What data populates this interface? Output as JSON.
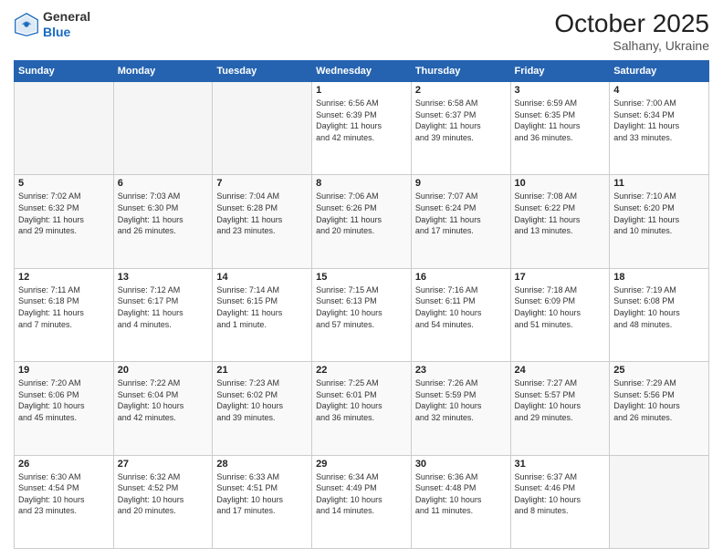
{
  "header": {
    "logo_general": "General",
    "logo_blue": "Blue",
    "month": "October 2025",
    "location": "Salhany, Ukraine"
  },
  "weekdays": [
    "Sunday",
    "Monday",
    "Tuesday",
    "Wednesday",
    "Thursday",
    "Friday",
    "Saturday"
  ],
  "weeks": [
    [
      {
        "day": "",
        "info": ""
      },
      {
        "day": "",
        "info": ""
      },
      {
        "day": "",
        "info": ""
      },
      {
        "day": "1",
        "info": "Sunrise: 6:56 AM\nSunset: 6:39 PM\nDaylight: 11 hours\nand 42 minutes."
      },
      {
        "day": "2",
        "info": "Sunrise: 6:58 AM\nSunset: 6:37 PM\nDaylight: 11 hours\nand 39 minutes."
      },
      {
        "day": "3",
        "info": "Sunrise: 6:59 AM\nSunset: 6:35 PM\nDaylight: 11 hours\nand 36 minutes."
      },
      {
        "day": "4",
        "info": "Sunrise: 7:00 AM\nSunset: 6:34 PM\nDaylight: 11 hours\nand 33 minutes."
      }
    ],
    [
      {
        "day": "5",
        "info": "Sunrise: 7:02 AM\nSunset: 6:32 PM\nDaylight: 11 hours\nand 29 minutes."
      },
      {
        "day": "6",
        "info": "Sunrise: 7:03 AM\nSunset: 6:30 PM\nDaylight: 11 hours\nand 26 minutes."
      },
      {
        "day": "7",
        "info": "Sunrise: 7:04 AM\nSunset: 6:28 PM\nDaylight: 11 hours\nand 23 minutes."
      },
      {
        "day": "8",
        "info": "Sunrise: 7:06 AM\nSunset: 6:26 PM\nDaylight: 11 hours\nand 20 minutes."
      },
      {
        "day": "9",
        "info": "Sunrise: 7:07 AM\nSunset: 6:24 PM\nDaylight: 11 hours\nand 17 minutes."
      },
      {
        "day": "10",
        "info": "Sunrise: 7:08 AM\nSunset: 6:22 PM\nDaylight: 11 hours\nand 13 minutes."
      },
      {
        "day": "11",
        "info": "Sunrise: 7:10 AM\nSunset: 6:20 PM\nDaylight: 11 hours\nand 10 minutes."
      }
    ],
    [
      {
        "day": "12",
        "info": "Sunrise: 7:11 AM\nSunset: 6:18 PM\nDaylight: 11 hours\nand 7 minutes."
      },
      {
        "day": "13",
        "info": "Sunrise: 7:12 AM\nSunset: 6:17 PM\nDaylight: 11 hours\nand 4 minutes."
      },
      {
        "day": "14",
        "info": "Sunrise: 7:14 AM\nSunset: 6:15 PM\nDaylight: 11 hours\nand 1 minute."
      },
      {
        "day": "15",
        "info": "Sunrise: 7:15 AM\nSunset: 6:13 PM\nDaylight: 10 hours\nand 57 minutes."
      },
      {
        "day": "16",
        "info": "Sunrise: 7:16 AM\nSunset: 6:11 PM\nDaylight: 10 hours\nand 54 minutes."
      },
      {
        "day": "17",
        "info": "Sunrise: 7:18 AM\nSunset: 6:09 PM\nDaylight: 10 hours\nand 51 minutes."
      },
      {
        "day": "18",
        "info": "Sunrise: 7:19 AM\nSunset: 6:08 PM\nDaylight: 10 hours\nand 48 minutes."
      }
    ],
    [
      {
        "day": "19",
        "info": "Sunrise: 7:20 AM\nSunset: 6:06 PM\nDaylight: 10 hours\nand 45 minutes."
      },
      {
        "day": "20",
        "info": "Sunrise: 7:22 AM\nSunset: 6:04 PM\nDaylight: 10 hours\nand 42 minutes."
      },
      {
        "day": "21",
        "info": "Sunrise: 7:23 AM\nSunset: 6:02 PM\nDaylight: 10 hours\nand 39 minutes."
      },
      {
        "day": "22",
        "info": "Sunrise: 7:25 AM\nSunset: 6:01 PM\nDaylight: 10 hours\nand 36 minutes."
      },
      {
        "day": "23",
        "info": "Sunrise: 7:26 AM\nSunset: 5:59 PM\nDaylight: 10 hours\nand 32 minutes."
      },
      {
        "day": "24",
        "info": "Sunrise: 7:27 AM\nSunset: 5:57 PM\nDaylight: 10 hours\nand 29 minutes."
      },
      {
        "day": "25",
        "info": "Sunrise: 7:29 AM\nSunset: 5:56 PM\nDaylight: 10 hours\nand 26 minutes."
      }
    ],
    [
      {
        "day": "26",
        "info": "Sunrise: 6:30 AM\nSunset: 4:54 PM\nDaylight: 10 hours\nand 23 minutes."
      },
      {
        "day": "27",
        "info": "Sunrise: 6:32 AM\nSunset: 4:52 PM\nDaylight: 10 hours\nand 20 minutes."
      },
      {
        "day": "28",
        "info": "Sunrise: 6:33 AM\nSunset: 4:51 PM\nDaylight: 10 hours\nand 17 minutes."
      },
      {
        "day": "29",
        "info": "Sunrise: 6:34 AM\nSunset: 4:49 PM\nDaylight: 10 hours\nand 14 minutes."
      },
      {
        "day": "30",
        "info": "Sunrise: 6:36 AM\nSunset: 4:48 PM\nDaylight: 10 hours\nand 11 minutes."
      },
      {
        "day": "31",
        "info": "Sunrise: 6:37 AM\nSunset: 4:46 PM\nDaylight: 10 hours\nand 8 minutes."
      },
      {
        "day": "",
        "info": ""
      }
    ]
  ]
}
